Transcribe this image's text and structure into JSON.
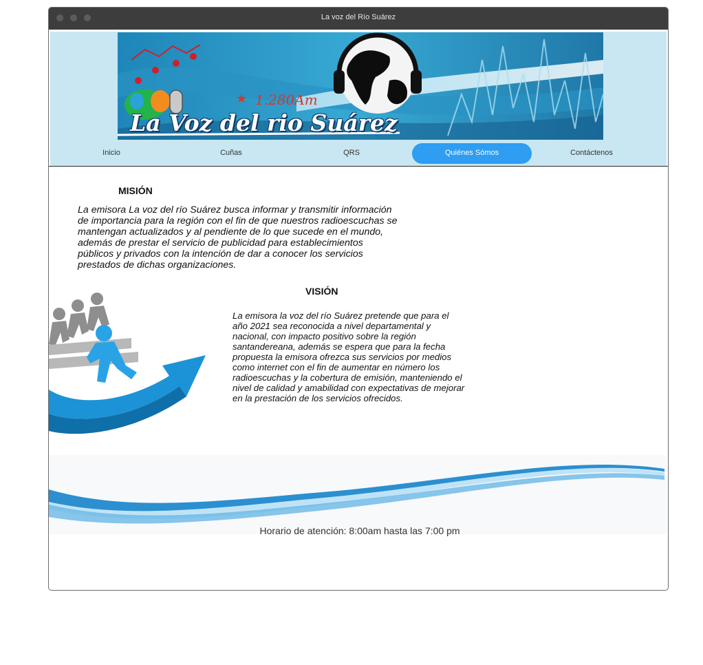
{
  "window": {
    "title": "La voz del Río Suárez"
  },
  "banner": {
    "brand_text": "La Voz del rio Suárez",
    "frequency": "1.280Am"
  },
  "nav": {
    "items": [
      {
        "label": "Inicio",
        "active": false
      },
      {
        "label": "Cuñas",
        "active": false
      },
      {
        "label": "QRS",
        "active": false
      },
      {
        "label": "Quiénes Sómos",
        "active": true
      },
      {
        "label": "Contáctenos",
        "active": false
      }
    ]
  },
  "mision": {
    "title": "MISIÓN",
    "text": "La emisora La voz del río Suárez busca informar y transmitir información de importancia para la región con el fin de que nuestros radioescuchas se mantengan actualizados y al pendiente de lo que sucede en el mundo, además de prestar el servicio de publicidad para establecimientos públicos y privados con la intención de dar a conocer los servicios prestados de dichas organizaciones."
  },
  "vision": {
    "title": "VISIÓN",
    "text": "La emisora la voz del río Suárez pretende que para el año 2021 sea reconocida a nivel departamental y nacional, con impacto positivo sobre la región santandereana, además se espera que para la fecha propuesta la emisora ofrezca sus servicios por medios como internet con el fin de aumentar en número los radioescuchas y la cobertura de emisión, manteniendo el nivel de calidad y amabilidad con expectativas de mejorar en la prestación de los servicios ofrecidos."
  },
  "footer": {
    "hours": "Horario de atención: 8:00am hasta las 7:00 pm"
  },
  "colors": {
    "header_bg": "#c8e7f2",
    "nav_active": "#2e9df2",
    "titlebar": "#3d3d3d"
  }
}
